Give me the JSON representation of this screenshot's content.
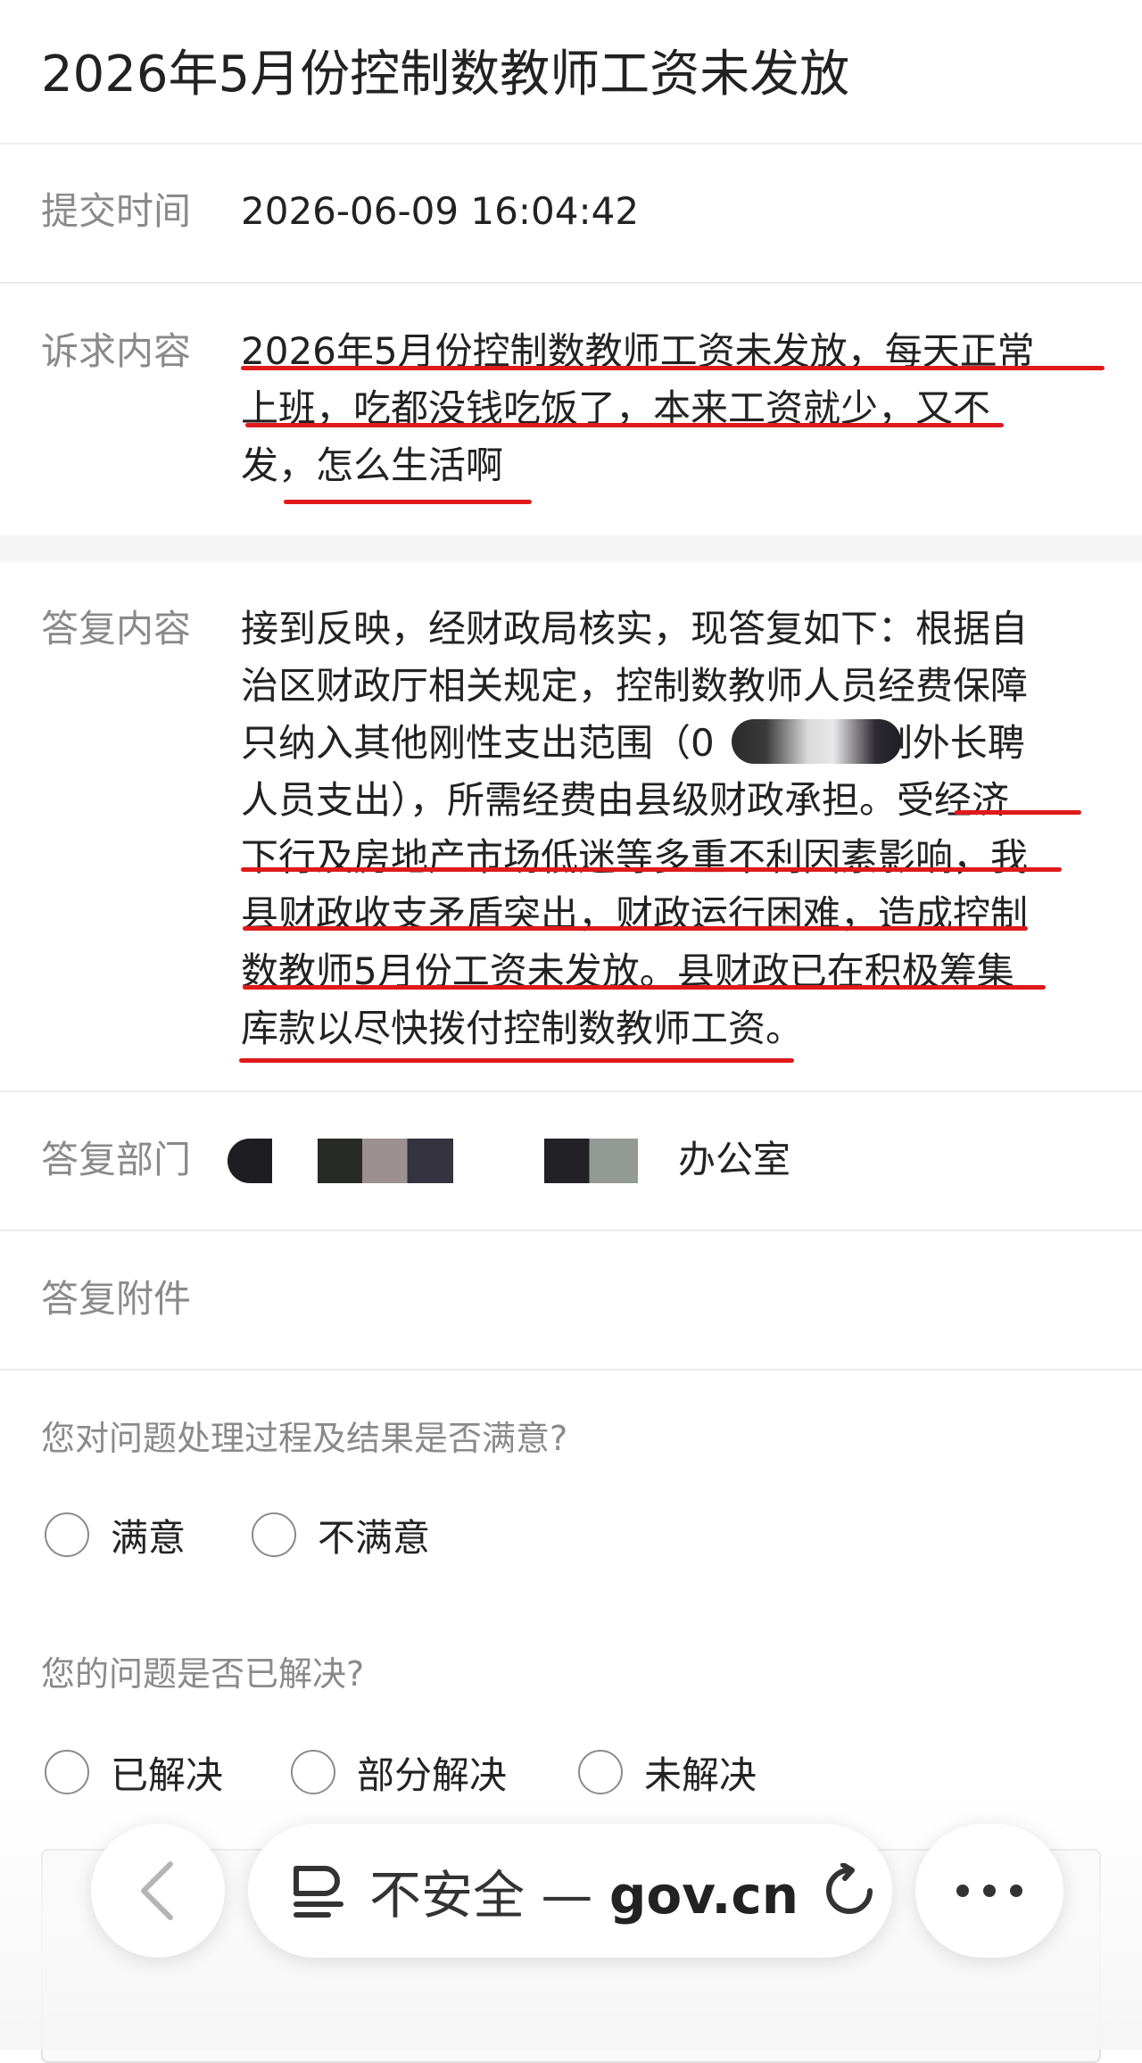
{
  "title": "2026年5月份控制数教师工资未发放",
  "submit_time": {
    "label": "提交时间",
    "value": "2026-06-09 16:04:42"
  },
  "appeal": {
    "label": "诉求内容",
    "lines": [
      "2026年5月份控制数教师工资未发放，每天正常",
      "上班，吃都没钱吃饭了，本来工资就少，又不",
      "发，怎么生活啊"
    ]
  },
  "reply": {
    "label": "答复内容",
    "lines": [
      "接到反映，经财政局核实，现答复如下：根据自",
      "治区财政厅相关规定，控制数教师人员经费保障",
      "只纳入其他刚性支出范围（0",
      "人员支出），所需经费由县级财政承担。受经济",
      "下行及房地产市场低迷等多重不利因素影响，我",
      "县财政收支矛盾突出，财政运行困难，造成控制",
      "数教师5月份工资未发放。县财政已在积极筹集",
      "库款以尽快拨付控制数教师工资。"
    ],
    "line3_tail": "制外长聘"
  },
  "department": {
    "label": "答复部门",
    "value_suffix": "办公室"
  },
  "attachment": {
    "label": "答复附件"
  },
  "satisfaction": {
    "question": "您对问题处理过程及结果是否满意?",
    "options": [
      "满意",
      "不满意"
    ]
  },
  "resolved": {
    "question": "您的问题是否已解决?",
    "options": [
      "已解决",
      "部分解决",
      "未解决"
    ]
  },
  "browser": {
    "url_prefix": "不安全 —",
    "url_domain": "gov.cn",
    "icons": {
      "back": "chevron-left-icon",
      "reader": "reader-mode-icon",
      "reload": "reload-icon",
      "more": "more-dots-icon"
    }
  },
  "colors": {
    "underline": "#e0191a",
    "label": "#8a8a8a",
    "text": "#222222"
  }
}
